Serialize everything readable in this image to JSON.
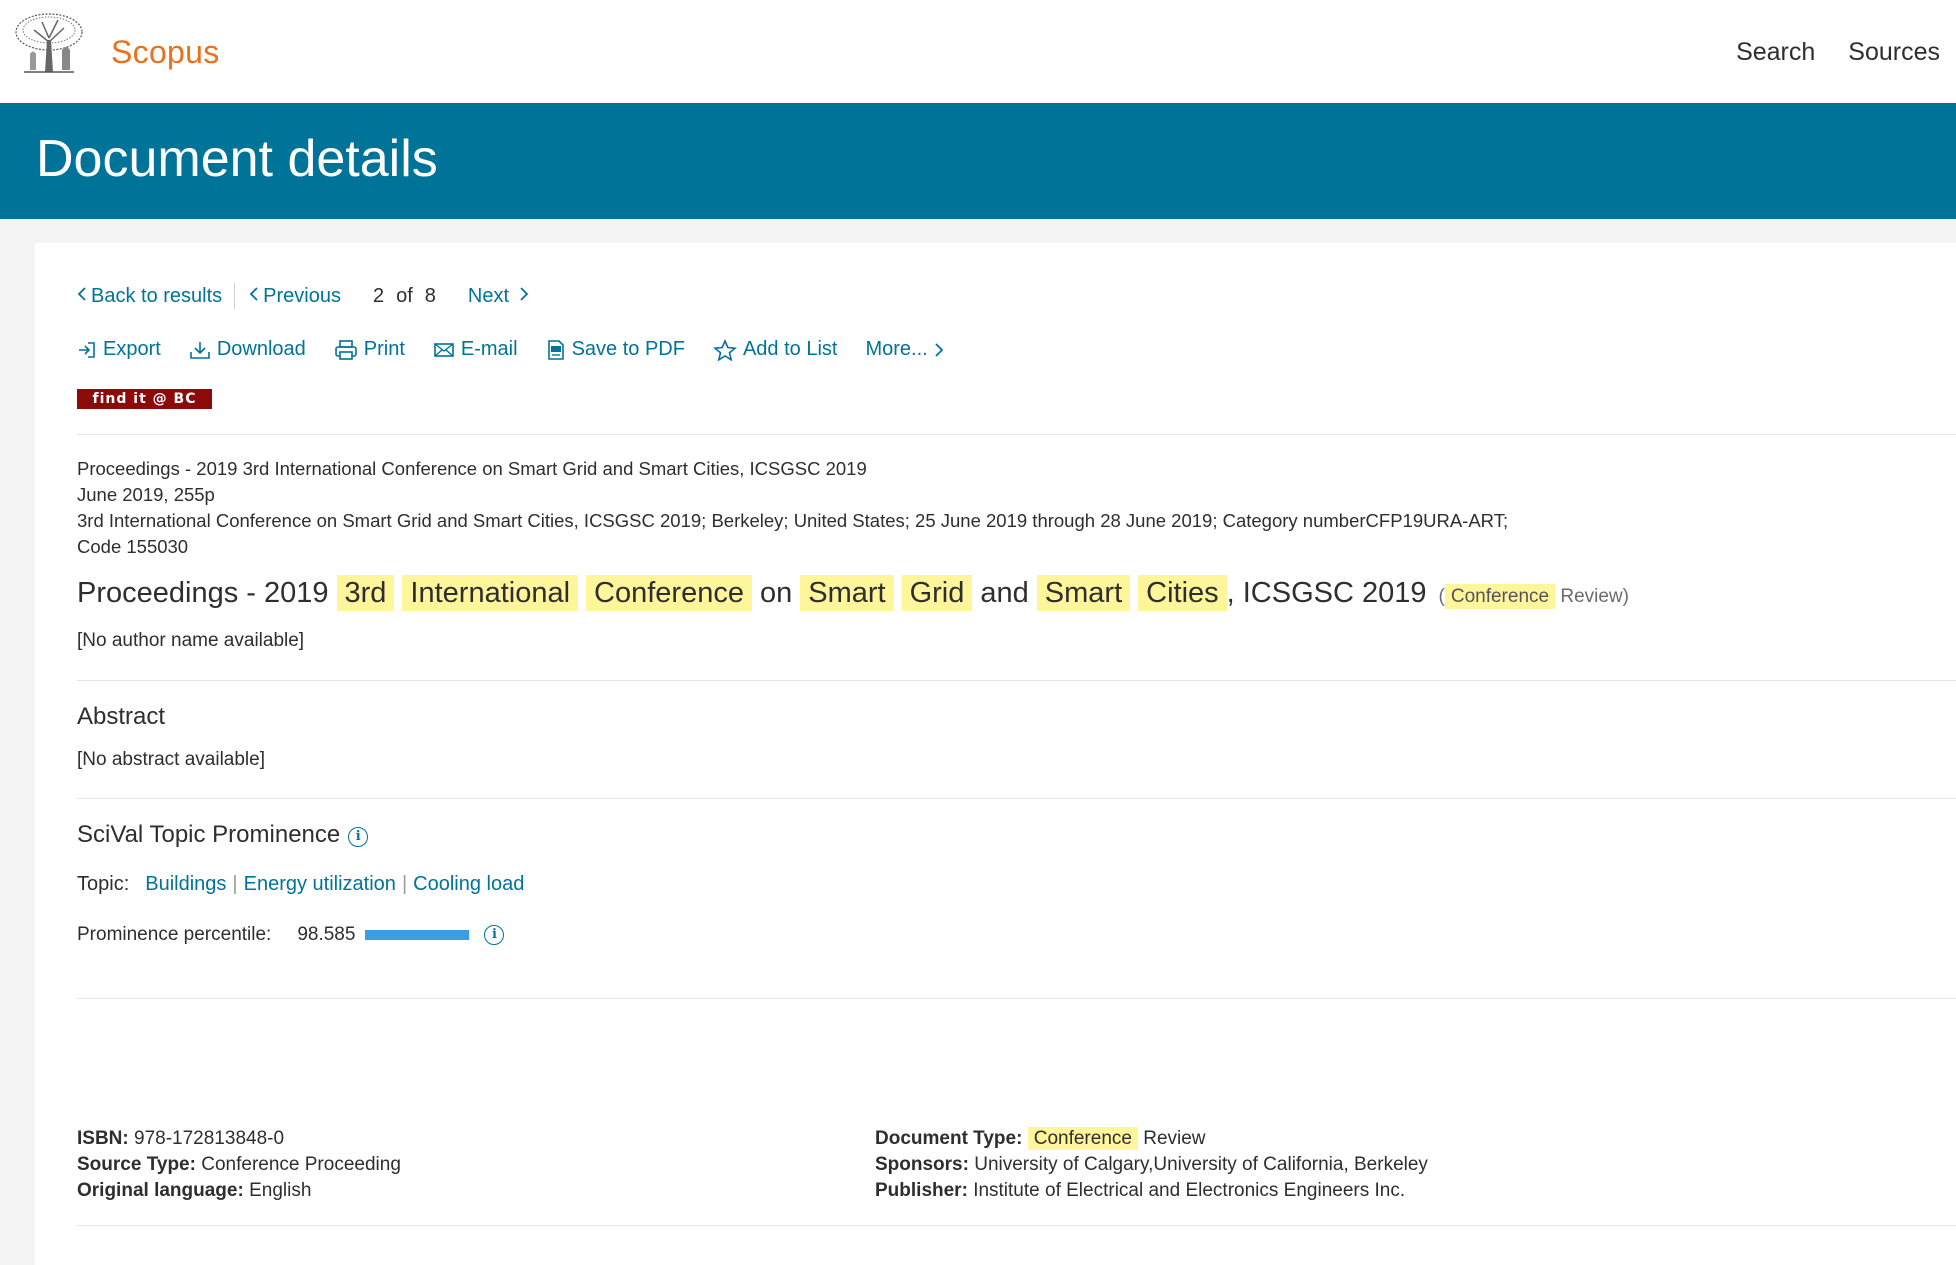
{
  "brand": {
    "name": "Scopus",
    "logo": "elsevier-tree-logo"
  },
  "topnav": [
    "Search",
    "Sources"
  ],
  "banner": {
    "title": "Document details"
  },
  "nav": {
    "back": "Back to results",
    "previous": "Previous",
    "current": "2",
    "of": "of",
    "total": "8",
    "next": "Next"
  },
  "toolbar": [
    {
      "label": "Export",
      "icon": "export-icon"
    },
    {
      "label": "Download",
      "icon": "download-icon"
    },
    {
      "label": "Print",
      "icon": "print-icon"
    },
    {
      "label": "E-mail",
      "icon": "email-icon"
    },
    {
      "label": "Save to PDF",
      "icon": "pdf-icon"
    },
    {
      "label": "Add to List",
      "icon": "star-icon"
    },
    {
      "label": "More...",
      "icon": "chevron-right-icon"
    }
  ],
  "findit": "find it @ BC",
  "meta": {
    "line1": "Proceedings - 2019 3rd International Conference on Smart Grid and Smart Cities, ICSGSC 2019",
    "line2": "June 2019, 255p",
    "line3": "3rd International Conference on Smart Grid and Smart Cities, ICSGSC 2019; Berkeley; United States; 25 June 2019 through 28 June 2019; Category numberCFP19URA-ART;",
    "line4": "Code 155030"
  },
  "title": {
    "words": [
      {
        "text": "Proceedings - 2019",
        "hl": false
      },
      {
        "text": "3rd",
        "hl": true
      },
      {
        "text": "International",
        "hl": true
      },
      {
        "text": "Conference",
        "hl": true
      },
      {
        "text": "on",
        "hl": false
      },
      {
        "text": "Smart",
        "hl": true
      },
      {
        "text": "Grid",
        "hl": true
      },
      {
        "text": "and",
        "hl": false
      },
      {
        "text": "Smart",
        "hl": true
      },
      {
        "text": "Cities",
        "hl": true
      },
      {
        "text": ", ICSGSC 2019",
        "hl": false
      }
    ],
    "doctype_open": "(",
    "doctype_hl": "Conference",
    "doctype_rest": "Review)"
  },
  "authors": "[No author name available]",
  "abstract": {
    "heading": "Abstract",
    "text": "[No abstract available]"
  },
  "scival": {
    "heading": "SciVal Topic Prominence",
    "topic_label": "Topic:",
    "topics": [
      "Buildings",
      "Energy utilization",
      "Cooling load"
    ],
    "prominence_label": "Prominence percentile:",
    "prominence_value": "98.585",
    "prominence_fraction": 0.98585,
    "bar_color": "#3a9ee0"
  },
  "details": {
    "isbn_label": "ISBN:",
    "isbn": "978-172813848-0",
    "source_type_label": "Source Type:",
    "source_type": "Conference Proceeding",
    "language_label": "Original language:",
    "language": "English",
    "doctype_label": "Document Type:",
    "doctype_hl": "Conference",
    "doctype_rest": "Review",
    "sponsors_label": "Sponsors:",
    "sponsors": "University of Calgary,University of California, Berkeley",
    "publisher_label": "Publisher:",
    "publisher": "Institute of Electrical and Electronics Engineers Inc."
  },
  "colors": {
    "accent": "#007398",
    "brand": "#e9711c",
    "highlight": "#fff59b",
    "findit_bg": "#8b0b0b"
  }
}
